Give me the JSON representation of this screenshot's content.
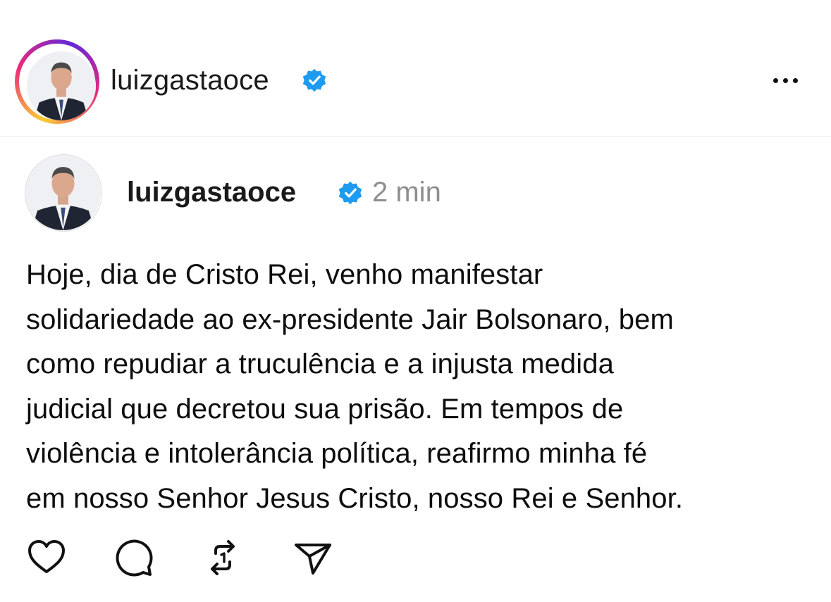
{
  "header": {
    "username": "luizgastaoce",
    "verified_icon": "verified-badge-icon",
    "more_icon": "more-dots-icon"
  },
  "post": {
    "username": "luizgastaoce",
    "time": "2 min",
    "text": "Hoje, dia de Cristo Rei, venho manifestar\nsolidariedade ao ex-presidente Jair Bolsonaro, bem\ncomo repudiar a truculência e a injusta medida\njudicial que decretou sua prisão. Em tempos de\nviolência e intolerância política, reafirmo minha fé\nem nosso Senhor Jesus Cristo, nosso Rei e Senhor.",
    "actions": [
      "heart-icon",
      "comment-icon",
      "repost-icon",
      "share-icon"
    ]
  },
  "colors": {
    "verified": "#1d9bf0",
    "muted": "#8e8e8e",
    "text": "#111111"
  }
}
